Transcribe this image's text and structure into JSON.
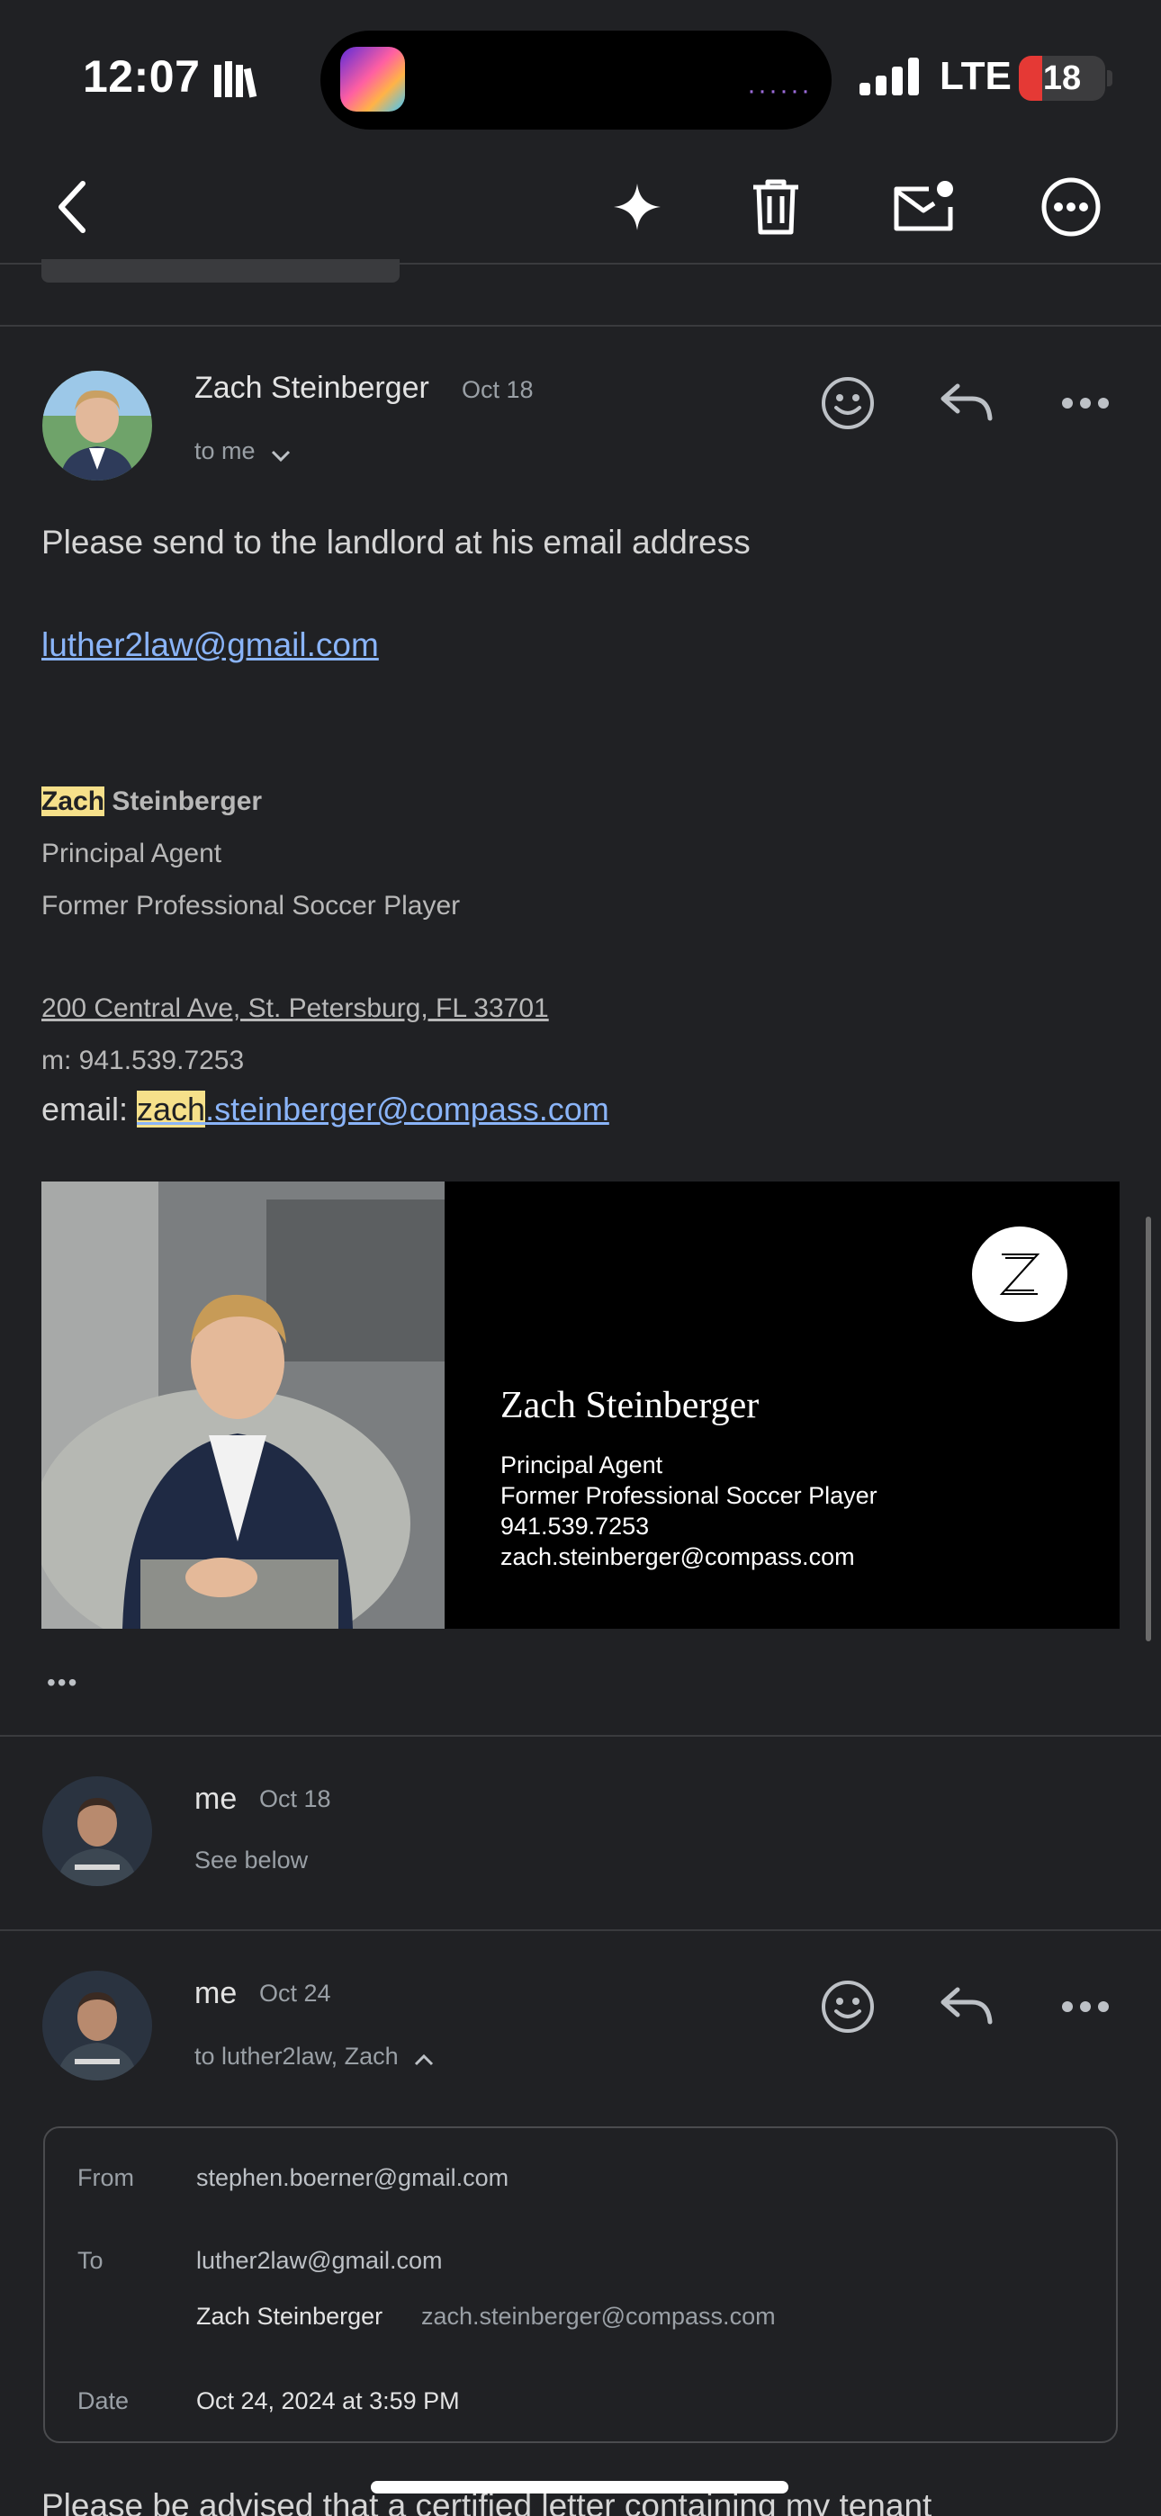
{
  "status_bar": {
    "time": "12:07",
    "network": "LTE",
    "battery": "18"
  },
  "email1": {
    "sender": "Zach Steinberger",
    "date": "Oct 18",
    "recipient": "to me",
    "body": "Please send to the landlord at his email address",
    "link_email": "luther2law@gmail.com",
    "sig_first": "Zach",
    "sig_last": "Steinberger",
    "sig_title": "Principal Agent",
    "sig_subtitle": "Former Professional Soccer Player",
    "sig_address": "200 Central Ave, St. Petersburg, FL 33701",
    "sig_mobile": "m: 941.539.7253",
    "sig_email_label": "email: ",
    "sig_email_hl": "zach",
    "sig_email_rest": ".steinberger@compass.com",
    "card": {
      "name": "Zach Steinberger",
      "title": "Principal Agent",
      "subtitle": "Former Professional Soccer Player",
      "phone": "941.539.7253",
      "email": "zach.steinberger@compass.com"
    },
    "more": "•••"
  },
  "email2": {
    "sender": "me",
    "date": "Oct 18",
    "snippet": "See below"
  },
  "email3": {
    "sender": "me",
    "date": "Oct 24",
    "recipients": "to luther2law, Zach",
    "details": {
      "from_label": "From",
      "from": "stephen.boerner@gmail.com",
      "to_label": "To",
      "to1": "luther2law@gmail.com",
      "to2_name": "Zach Steinberger",
      "to2_email": "zach.steinberger@compass.com",
      "date_label": "Date",
      "date": "Oct 24, 2024 at 3:59 PM"
    },
    "body_start": "Please be advised that a certified letter containing my tenant"
  }
}
